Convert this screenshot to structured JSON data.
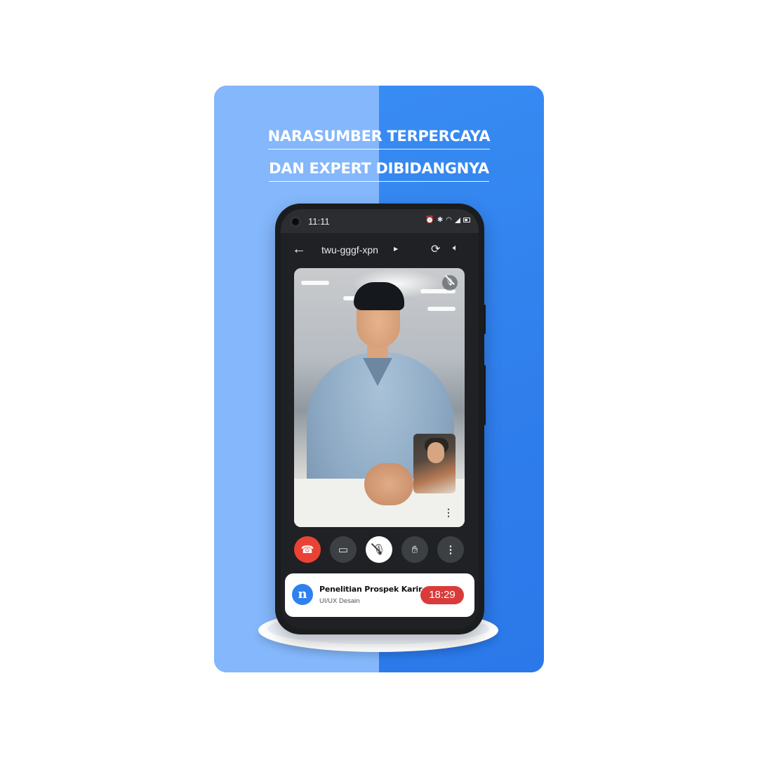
{
  "promo": {
    "headline_line1": "NARASUMBER TERPERCAYA",
    "headline_line2": "DAN EXPERT DIBIDANGNYA"
  },
  "status_bar": {
    "time": "11:11",
    "icons": [
      "alarm-icon",
      "bluetooth-icon",
      "wifi-icon",
      "signal-icon",
      "battery-icon"
    ]
  },
  "meeting": {
    "code": "twu-gggf-xpn",
    "back_icon": "arrow-left-icon",
    "switch_camera_icon": "camera-flip-icon",
    "audio_output_icon": "speaker-icon"
  },
  "controls": [
    {
      "name": "end-call",
      "icon": "phone-hangup-icon"
    },
    {
      "name": "camera",
      "icon": "video-camera-icon"
    },
    {
      "name": "microphone",
      "icon": "mic-off-icon"
    },
    {
      "name": "raise-hand",
      "icon": "hand-icon"
    },
    {
      "name": "more-options",
      "icon": "more-vert-icon"
    }
  ],
  "session_card": {
    "title": "Penelitian Prospek Karir",
    "subtitle": "UI/UX Desain",
    "timer": "18:29"
  },
  "colors": {
    "card_blue": "#2f7eec",
    "card_light_blue": "#84b7fb",
    "end_call_red": "#ea4335",
    "timer_red": "#d93b3b"
  }
}
